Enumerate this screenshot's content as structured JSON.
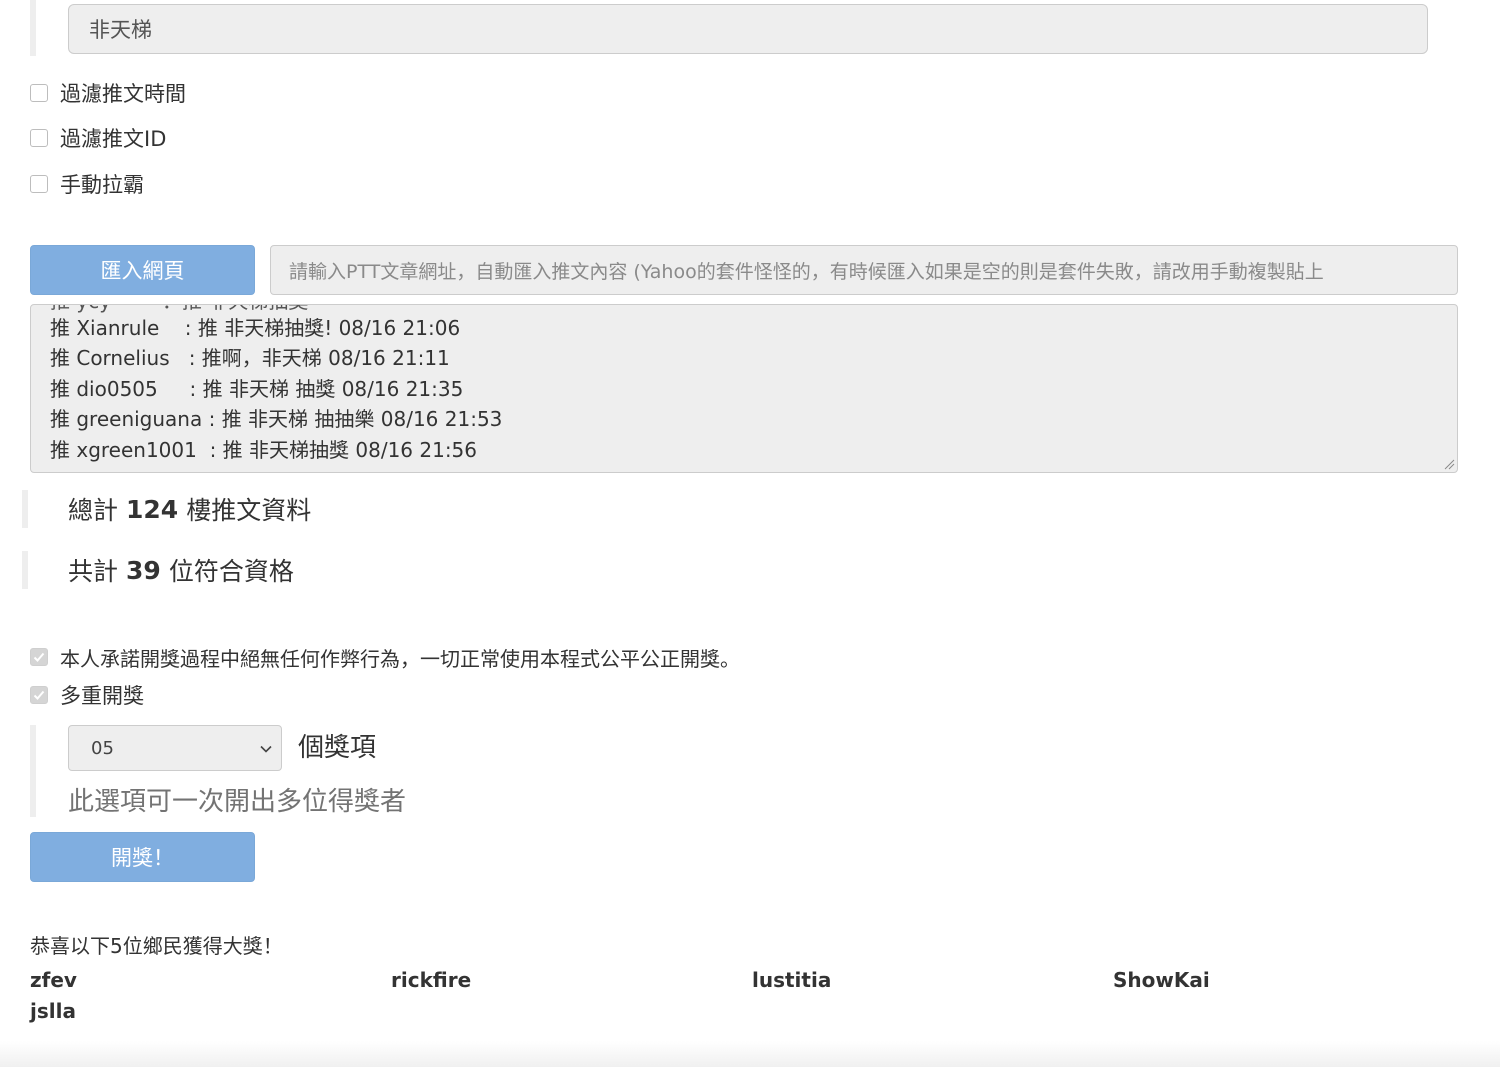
{
  "keyword": {
    "value": "非天梯"
  },
  "filters": [
    {
      "label": "過濾推文時間",
      "checked": false
    },
    {
      "label": "過濾推文ID",
      "checked": false
    },
    {
      "label": "手動拉霸",
      "checked": false
    }
  ],
  "import": {
    "button_label": "匯入網頁",
    "url_placeholder": "請輸入PTT文章網址，自動匯入推文內容 (Yahoo的套件怪怪的，有時候匯入如果是空的則是套件失敗，請改用手動複製貼上"
  },
  "pushes": {
    "cut_line": "推 ycy        ：推 非天梯抽獎",
    "lines": [
      "推 Xianrule    : 推 非天梯抽獎! 08/16 21:06",
      "推 Cornelius   : 推啊，非天梯 08/16 21:11",
      "推 dio0505     : 推 非天梯 抽獎 08/16 21:35",
      "推 greeniguana : 推 非天梯 抽抽樂 08/16 21:53",
      "推 xgreen1001  : 推 非天梯抽獎 08/16 21:56"
    ]
  },
  "stats": {
    "total_prefix": "總計",
    "total_count": "124",
    "total_suffix": "樓推文資料",
    "eligible_prefix": "共計",
    "eligible_count": "39",
    "eligible_suffix": "位符合資格"
  },
  "options": {
    "pledge_label": "本人承諾開獎過程中絕無任何作弊行為，一切正常使用本程式公平公正開獎。",
    "pledge_checked": true,
    "multi_label": "多重開獎",
    "multi_checked": true
  },
  "prize": {
    "selected": "05",
    "unit": "個獎項",
    "help": "此選項可一次開出多位得獎者"
  },
  "draw": {
    "button_label": "開獎！"
  },
  "result": {
    "congrats": "恭喜以下5位鄉民獲得大獎！",
    "winners": [
      "zfev",
      "rickfire",
      "lustitia",
      "ShowKai",
      "jslla"
    ]
  },
  "colors": {
    "button_blue": "#80aee0",
    "input_gray": "#eeeeee"
  }
}
